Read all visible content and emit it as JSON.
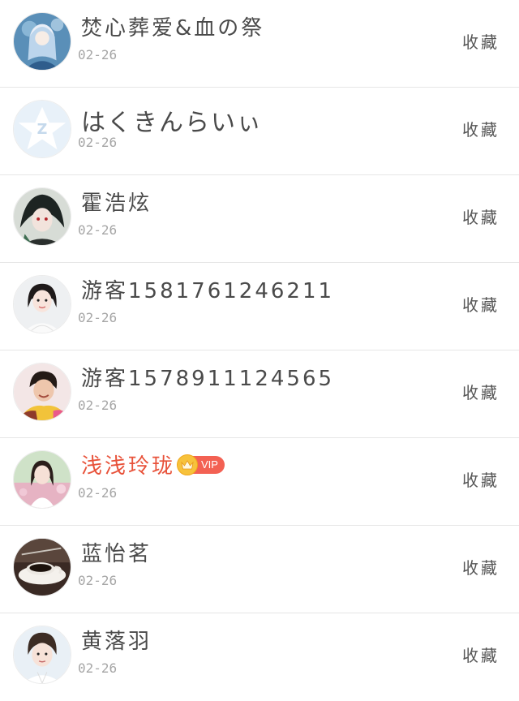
{
  "fav_label": "收藏",
  "rows": [
    {
      "name": "焚心葬爱&血の祭",
      "date": "02-26",
      "vip": false,
      "avatar": "anime-girl"
    },
    {
      "name": "はくきんらいぃ",
      "date": "02-26",
      "vip": false,
      "avatar": "default-z"
    },
    {
      "name": "霍浩炫",
      "date": "02-26",
      "vip": false,
      "avatar": "dark-anime"
    },
    {
      "name": "游客1581761246211",
      "date": "02-26",
      "vip": false,
      "avatar": "girl-photo"
    },
    {
      "name": "游客1578911124565",
      "date": "02-26",
      "vip": false,
      "avatar": "boy-photo"
    },
    {
      "name": "浅浅玲珑",
      "date": "02-26",
      "vip": true,
      "vip_label": "VIP",
      "avatar": "girl-outdoor"
    },
    {
      "name": "蓝怡茗",
      "date": "02-26",
      "vip": false,
      "avatar": "coffee-cup"
    },
    {
      "name": "黄落羽",
      "date": "02-26",
      "vip": false,
      "avatar": "boy-portrait"
    }
  ],
  "colors": {
    "vip_name": "#e8523a",
    "vip_badge": "#f36153",
    "crown": "#f7c23b",
    "divider": "#e6e6e6"
  }
}
